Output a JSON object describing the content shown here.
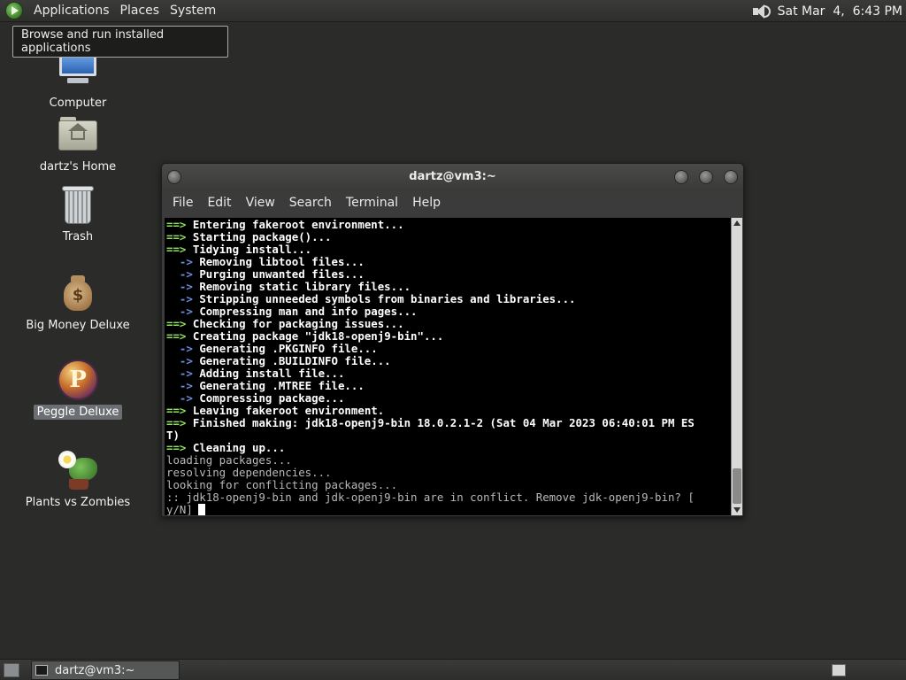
{
  "top_panel": {
    "menus": [
      "Applications",
      "Places",
      "System"
    ],
    "clock": "Sat Mar  4,  6:43 PM",
    "volume_icon": "speaker-icon"
  },
  "tooltip": {
    "text": "Browse and run installed applications"
  },
  "desktop": {
    "icons": [
      {
        "label": "Computer",
        "icon": "computer-icon"
      },
      {
        "label": "dartz's Home",
        "icon": "home-folder-icon"
      },
      {
        "label": "Trash",
        "icon": "trash-icon"
      },
      {
        "label": "Big Money Deluxe",
        "icon": "money-bag-icon"
      },
      {
        "label": "Peggle Deluxe",
        "icon": "peggle-icon",
        "selected": true
      },
      {
        "label": "Plants vs Zombies",
        "icon": "plants-vs-zombies-icon"
      }
    ]
  },
  "terminal": {
    "title": "dartz@vm3:~",
    "menu": [
      "File",
      "Edit",
      "View",
      "Search",
      "Terminal",
      "Help"
    ],
    "lines": [
      {
        "prefix": "==>",
        "kind": "arrow",
        "text": "Entering fakeroot environment..."
      },
      {
        "prefix": "==>",
        "kind": "arrow",
        "text": "Starting package()..."
      },
      {
        "prefix": "==>",
        "kind": "arrow",
        "text": "Tidying install..."
      },
      {
        "prefix": "  ->",
        "kind": "sub",
        "text": "Removing libtool files..."
      },
      {
        "prefix": "  ->",
        "kind": "sub",
        "text": "Purging unwanted files..."
      },
      {
        "prefix": "  ->",
        "kind": "sub",
        "text": "Removing static library files..."
      },
      {
        "prefix": "  ->",
        "kind": "sub",
        "text": "Stripping unneeded symbols from binaries and libraries..."
      },
      {
        "prefix": "  ->",
        "kind": "sub",
        "text": "Compressing man and info pages..."
      },
      {
        "prefix": "==>",
        "kind": "arrow",
        "text": "Checking for packaging issues..."
      },
      {
        "prefix": "==>",
        "kind": "arrow",
        "text": "Creating package \"jdk18-openj9-bin\"..."
      },
      {
        "prefix": "  ->",
        "kind": "sub",
        "text": "Generating .PKGINFO file..."
      },
      {
        "prefix": "  ->",
        "kind": "sub",
        "text": "Generating .BUILDINFO file..."
      },
      {
        "prefix": "  ->",
        "kind": "sub",
        "text": "Adding install file..."
      },
      {
        "prefix": "  ->",
        "kind": "sub",
        "text": "Generating .MTREE file..."
      },
      {
        "prefix": "  ->",
        "kind": "sub",
        "text": "Compressing package..."
      },
      {
        "prefix": "==>",
        "kind": "arrow",
        "text": "Leaving fakeroot environment."
      },
      {
        "prefix": "==>",
        "kind": "arrow",
        "text": "Finished making: jdk18-openj9-bin 18.0.2.1-2 (Sat 04 Mar 2023 06:40:01 PM ES"
      },
      {
        "prefix": "",
        "kind": "bold",
        "text": "T)"
      },
      {
        "prefix": "==>",
        "kind": "arrow",
        "text": "Cleaning up..."
      },
      {
        "prefix": "",
        "kind": "plain",
        "text": "loading packages..."
      },
      {
        "prefix": "",
        "kind": "plain",
        "text": "resolving dependencies..."
      },
      {
        "prefix": "",
        "kind": "plain",
        "text": "looking for conflicting packages..."
      },
      {
        "prefix": "",
        "kind": "plain",
        "text": ":: jdk18-openj9-bin and jdk-openj9-bin are in conflict. Remove jdk-openj9-bin? ["
      },
      {
        "prefix": "",
        "kind": "prompt",
        "text": "y/N]"
      }
    ]
  },
  "bottom_panel": {
    "task": "dartz@vm3:~"
  }
}
